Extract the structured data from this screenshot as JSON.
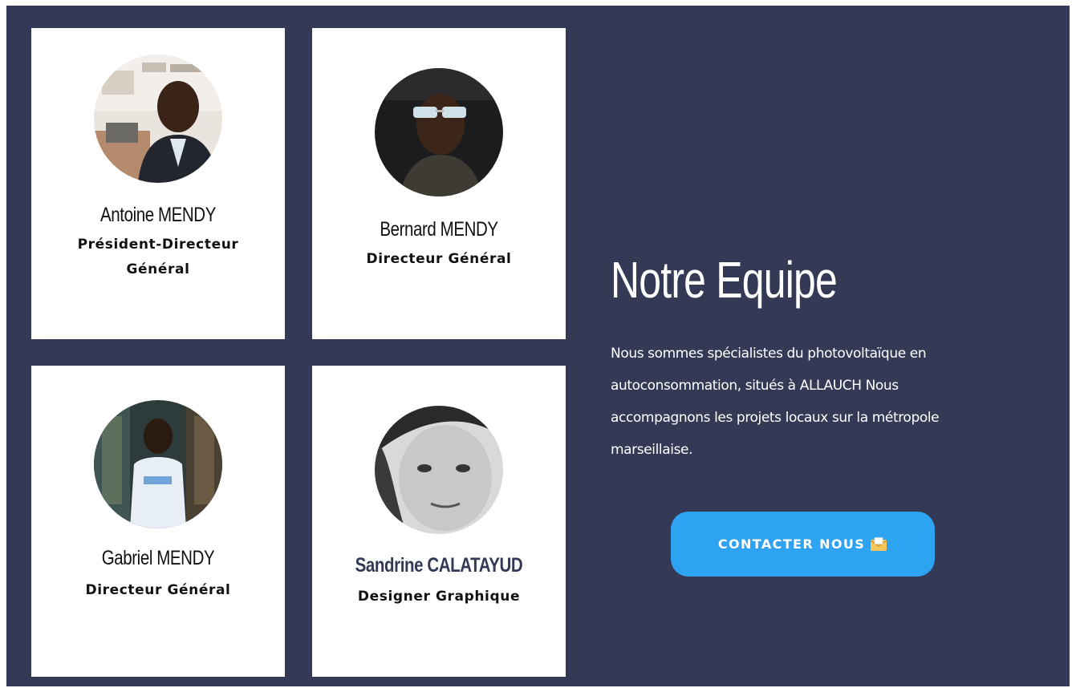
{
  "team": [
    {
      "name": "Antoine MENDY",
      "role": "Président-Directeur Général",
      "name_bold": false
    },
    {
      "name": "Bernard MENDY",
      "role": "Directeur Général",
      "name_bold": false
    },
    {
      "name": "Gabriel MENDY",
      "role": "Directeur Général",
      "name_bold": false
    },
    {
      "name": "Sandrine CALATAYUD",
      "role": "Designer Graphique",
      "name_bold": true
    }
  ],
  "intro": {
    "title": "Notre Equipe",
    "description": "Nous sommes spécialistes du photovoltaïque en autoconsommation, situés à ALLAUCH Nous accompagnons les projets locaux sur la métropole marseillaise."
  },
  "cta": {
    "label": "CONTACTER NOUS",
    "icon": "envelope-icon"
  },
  "colors": {
    "background": "#343956",
    "card": "#ffffff",
    "cta": "#2ea3f2",
    "accent_name": "#343956"
  }
}
